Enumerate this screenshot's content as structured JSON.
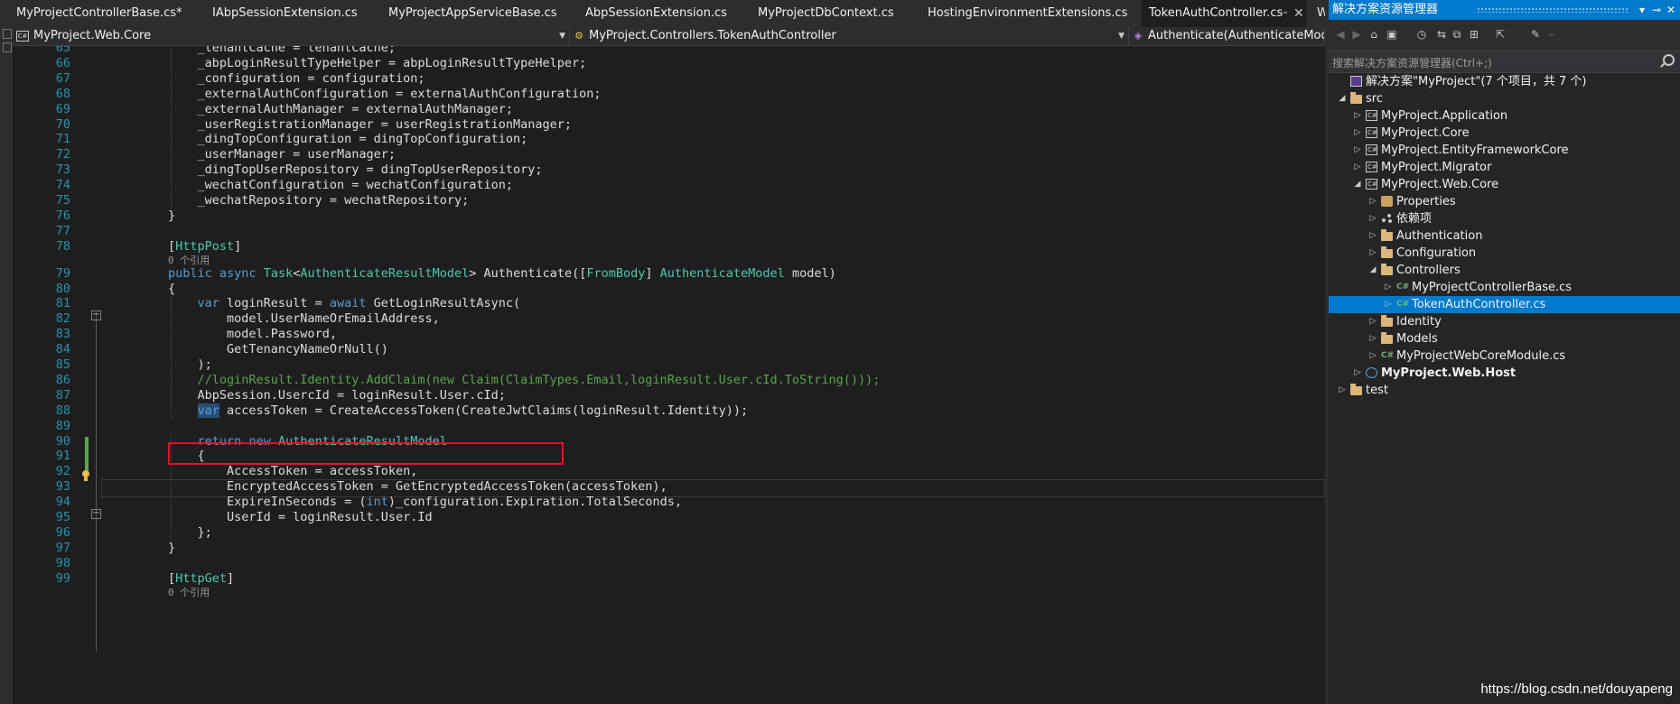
{
  "tabs": [
    {
      "label": "MyProjectControllerBase.cs*",
      "active": false
    },
    {
      "label": "IAbpSessionExtension.cs",
      "active": false
    },
    {
      "label": "MyProjectAppServiceBase.cs",
      "active": false
    },
    {
      "label": "AbpSessionExtension.cs",
      "active": false
    },
    {
      "label": "MyProjectDbContext.cs",
      "active": false
    },
    {
      "label": "HostingEnvironmentExtensions.cs",
      "active": false
    },
    {
      "label": "TokenAuthController.cs",
      "active": true,
      "pin": "⊸",
      "close": "✕"
    },
    {
      "label": "W",
      "active": false
    }
  ],
  "navbar": {
    "project": "MyProject.Web.Core",
    "type": "MyProject.Controllers.TokenAuthController",
    "member": "Authenticate(AuthenticateModel model)"
  },
  "code_lines": [
    {
      "n": "65",
      "indent": 12,
      "tokens": [
        {
          "t": "_tenantCache = tenantCache;"
        }
      ]
    },
    {
      "n": "66",
      "indent": 12,
      "tokens": [
        {
          "t": "_abpLoginResultTypeHelper = abpLoginResultTypeHelper;"
        }
      ]
    },
    {
      "n": "67",
      "indent": 12,
      "tokens": [
        {
          "t": "_configuration = configuration;"
        }
      ]
    },
    {
      "n": "68",
      "indent": 12,
      "tokens": [
        {
          "t": "_externalAuthConfiguration = externalAuthConfiguration;"
        }
      ]
    },
    {
      "n": "69",
      "indent": 12,
      "tokens": [
        {
          "t": "_externalAuthManager = externalAuthManager;"
        }
      ]
    },
    {
      "n": "70",
      "indent": 12,
      "tokens": [
        {
          "t": "_userRegistrationManager = userRegistrationManager;"
        }
      ]
    },
    {
      "n": "71",
      "indent": 12,
      "tokens": [
        {
          "t": "_dingTopConfiguration = dingTopConfiguration;"
        }
      ]
    },
    {
      "n": "72",
      "indent": 12,
      "tokens": [
        {
          "t": "_userManager = userManager;"
        }
      ]
    },
    {
      "n": "73",
      "indent": 12,
      "tokens": [
        {
          "t": "_dingTopUserRepository = dingTopUserRepository;"
        }
      ]
    },
    {
      "n": "74",
      "indent": 12,
      "tokens": [
        {
          "t": "_wechatConfiguration = wechatConfiguration;"
        }
      ]
    },
    {
      "n": "75",
      "indent": 12,
      "tokens": [
        {
          "t": "_wechatRepository = wechatRepository;"
        }
      ]
    },
    {
      "n": "76",
      "indent": 8,
      "tokens": [
        {
          "t": "}"
        }
      ]
    },
    {
      "n": "77",
      "indent": 0,
      "tokens": []
    },
    {
      "n": "78",
      "indent": 8,
      "tokens": [
        {
          "t": "["
        },
        {
          "t": "HttpPost",
          "c": "ty"
        },
        {
          "t": "]"
        }
      ],
      "lens": "0 个引用"
    },
    {
      "n": "79",
      "indent": 8,
      "tokens": [
        {
          "t": "public",
          "c": "kw"
        },
        {
          "t": " "
        },
        {
          "t": "async",
          "c": "kw"
        },
        {
          "t": " "
        },
        {
          "t": "Task",
          "c": "ty"
        },
        {
          "t": "<"
        },
        {
          "t": "AuthenticateResultModel",
          "c": "ty"
        },
        {
          "t": "> Authenticate(["
        },
        {
          "t": "FromBody",
          "c": "ty"
        },
        {
          "t": "] "
        },
        {
          "t": "AuthenticateModel",
          "c": "ty"
        },
        {
          "t": " model)"
        }
      ]
    },
    {
      "n": "80",
      "indent": 8,
      "tokens": [
        {
          "t": "{"
        }
      ]
    },
    {
      "n": "81",
      "indent": 12,
      "tokens": [
        {
          "t": "var",
          "c": "kw"
        },
        {
          "t": " loginResult = "
        },
        {
          "t": "await",
          "c": "kw"
        },
        {
          "t": " GetLoginResultAsync("
        }
      ]
    },
    {
      "n": "82",
      "indent": 16,
      "tokens": [
        {
          "t": "model.UserNameOrEmailAddress,"
        }
      ]
    },
    {
      "n": "83",
      "indent": 16,
      "tokens": [
        {
          "t": "model.Password,"
        }
      ]
    },
    {
      "n": "84",
      "indent": 16,
      "tokens": [
        {
          "t": "GetTenancyNameOrNull()"
        }
      ]
    },
    {
      "n": "85",
      "indent": 12,
      "tokens": [
        {
          "t": ");"
        }
      ]
    },
    {
      "n": "86",
      "indent": 12,
      "tokens": [
        {
          "t": "//loginResult.Identity.AddClaim(new Claim(ClaimTypes.Email,loginResult.User.cId.ToString()));",
          "c": "cm"
        }
      ]
    },
    {
      "n": "87",
      "indent": 12,
      "tokens": [
        {
          "t": "AbpSession.UsercId = loginResult.User.cId;"
        }
      ]
    },
    {
      "n": "88",
      "indent": 12,
      "tokens": [
        {
          "t": "var",
          "c": "sel"
        },
        {
          "t": " accessToken = CreateAccessToken(CreateJwtClaims(loginResult.Identity));"
        }
      ]
    },
    {
      "n": "89",
      "indent": 0,
      "tokens": []
    },
    {
      "n": "90",
      "indent": 12,
      "tokens": [
        {
          "t": "return",
          "c": "kw"
        },
        {
          "t": " "
        },
        {
          "t": "new",
          "c": "kw"
        },
        {
          "t": " "
        },
        {
          "t": "AuthenticateResultModel",
          "c": "ty"
        }
      ]
    },
    {
      "n": "91",
      "indent": 12,
      "tokens": [
        {
          "t": "{"
        }
      ]
    },
    {
      "n": "92",
      "indent": 16,
      "tokens": [
        {
          "t": "AccessToken = accessToken,"
        }
      ]
    },
    {
      "n": "93",
      "indent": 16,
      "tokens": [
        {
          "t": "EncryptedAccessToken = GetEncryptedAccessToken(accessToken),"
        }
      ]
    },
    {
      "n": "94",
      "indent": 16,
      "tokens": [
        {
          "t": "ExpireInSeconds = ("
        },
        {
          "t": "int",
          "c": "kw"
        },
        {
          "t": ")_configuration.Expiration.TotalSeconds,"
        }
      ]
    },
    {
      "n": "95",
      "indent": 16,
      "tokens": [
        {
          "t": "UserId = loginResult.User.Id"
        }
      ]
    },
    {
      "n": "96",
      "indent": 12,
      "tokens": [
        {
          "t": "};"
        }
      ]
    },
    {
      "n": "97",
      "indent": 8,
      "tokens": [
        {
          "t": "}"
        }
      ]
    },
    {
      "n": "98",
      "indent": 0,
      "tokens": []
    },
    {
      "n": "99",
      "indent": 8,
      "tokens": [
        {
          "t": "["
        },
        {
          "t": "HttpGet",
          "c": "ty"
        },
        {
          "t": "]"
        }
      ],
      "lens": "0 个引用"
    }
  ],
  "solution_explorer": {
    "title": "解决方案资源管理器",
    "title_buttons": [
      "▾",
      "⊸",
      "✕"
    ],
    "toolbar_icons": [
      "back-icon",
      "forward-icon",
      "home-icon",
      "switch-views-icon",
      "history-icon",
      "sync-icon",
      "collapse-all-icon",
      "show-all-files-icon",
      "preview-icon",
      "properties-icon",
      "pin-icon"
    ],
    "search_placeholder": "搜索解决方案资源管理器(Ctrl+;)",
    "items": [
      {
        "label": "解决方案\"MyProject\"(7 个项目，共 7 个)",
        "level": 0,
        "icon": "sln",
        "arrow": ""
      },
      {
        "label": "src",
        "level": 0,
        "icon": "folder",
        "arrow": "◢"
      },
      {
        "label": "MyProject.Application",
        "level": 1,
        "icon": "proj",
        "arrow": "▷"
      },
      {
        "label": "MyProject.Core",
        "level": 1,
        "icon": "proj",
        "arrow": "▷"
      },
      {
        "label": "MyProject.EntityFrameworkCore",
        "level": 1,
        "icon": "proj",
        "arrow": "▷"
      },
      {
        "label": "MyProject.Migrator",
        "level": 1,
        "icon": "proj",
        "arrow": "▷"
      },
      {
        "label": "MyProject.Web.Core",
        "level": 1,
        "icon": "proj",
        "arrow": "◢"
      },
      {
        "label": "Properties",
        "level": 2,
        "icon": "prop",
        "arrow": "▷"
      },
      {
        "label": "依赖项",
        "level": 2,
        "icon": "deps",
        "arrow": "▷"
      },
      {
        "label": "Authentication",
        "level": 2,
        "icon": "folder",
        "arrow": "▷"
      },
      {
        "label": "Configuration",
        "level": 2,
        "icon": "folder",
        "arrow": "▷"
      },
      {
        "label": "Controllers",
        "level": 2,
        "icon": "folder",
        "arrow": "◢"
      },
      {
        "label": "MyProjectControllerBase.cs",
        "level": 3,
        "icon": "cs",
        "arrow": "▷"
      },
      {
        "label": "TokenAuthController.cs",
        "level": 3,
        "icon": "cs",
        "arrow": "▷",
        "selected": true
      },
      {
        "label": "Identity",
        "level": 2,
        "icon": "folder",
        "arrow": "▷"
      },
      {
        "label": "Models",
        "level": 2,
        "icon": "folder",
        "arrow": "▷"
      },
      {
        "label": "MyProjectWebCoreModule.cs",
        "level": 2,
        "icon": "cs",
        "arrow": "▷"
      },
      {
        "label": "MyProject.Web.Host",
        "level": 1,
        "icon": "globe",
        "arrow": "▷",
        "bold": true
      },
      {
        "label": "test",
        "level": 0,
        "icon": "folder",
        "arrow": "▷"
      }
    ]
  },
  "watermark": "https://blog.csdn.net/douyapeng",
  "colors": {
    "accent": "#007acc",
    "keyword": "#569cd6",
    "type": "#4ec9b0",
    "comment": "#57a64a",
    "line_number": "#2b91af",
    "highlight_box": "#e81123"
  }
}
